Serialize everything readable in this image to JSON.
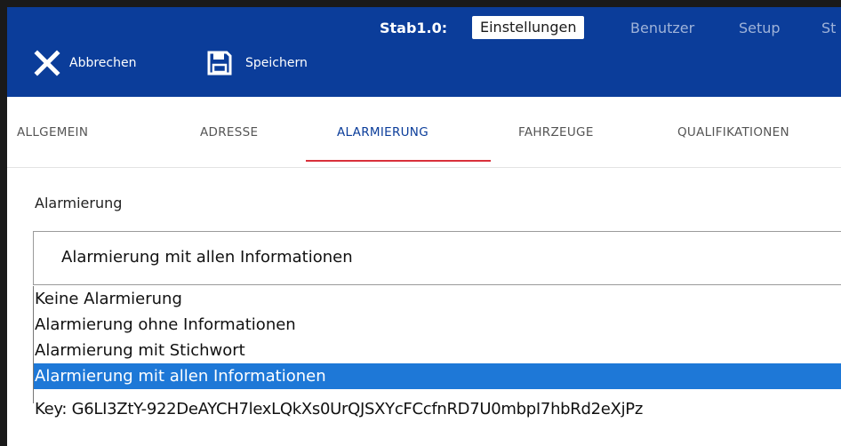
{
  "header": {
    "brand": "Stab1.0:",
    "nav": [
      {
        "label": "Einstellungen",
        "active": true
      },
      {
        "label": "Benutzer",
        "active": false
      },
      {
        "label": "Setup",
        "active": false
      },
      {
        "label": "St",
        "active": false
      }
    ],
    "actions": {
      "cancel_label": "Abbrechen",
      "cancel_icon": "close-icon",
      "save_label": "Speichern",
      "save_icon": "floppy-disk-icon"
    },
    "colors": {
      "background": "#0b3d9a",
      "text": "#ffffff",
      "inactive_nav": "#9fb3d9"
    }
  },
  "tabs": {
    "items": [
      {
        "label": "ALLGEMEIN"
      },
      {
        "label": "ADRESSE"
      },
      {
        "label": "ALARMIERUNG"
      },
      {
        "label": "FAHRZEUGE"
      },
      {
        "label": "QUALIFIKATIONEN"
      }
    ],
    "active_index": 2,
    "active_color": "#0b3d9a",
    "indicator_color": "#d9303b"
  },
  "form": {
    "field_label": "Alarmierung",
    "selected_value": "Alarmierung mit allen Informationen",
    "options": [
      {
        "label": "Keine Alarmierung"
      },
      {
        "label": "Alarmierung ohne Informationen"
      },
      {
        "label": "Alarmierung mit Stichwort"
      },
      {
        "label": "Alarmierung mit allen Informationen"
      }
    ],
    "highlighted_index": 3,
    "highlight_color": "#1e78d7"
  },
  "key_line": "Key: G6LI3ZtY-922DeAYCH7lexLQkXs0UrQJSXYcFCcfnRD7U0mbpI7hbRd2eXjPz"
}
